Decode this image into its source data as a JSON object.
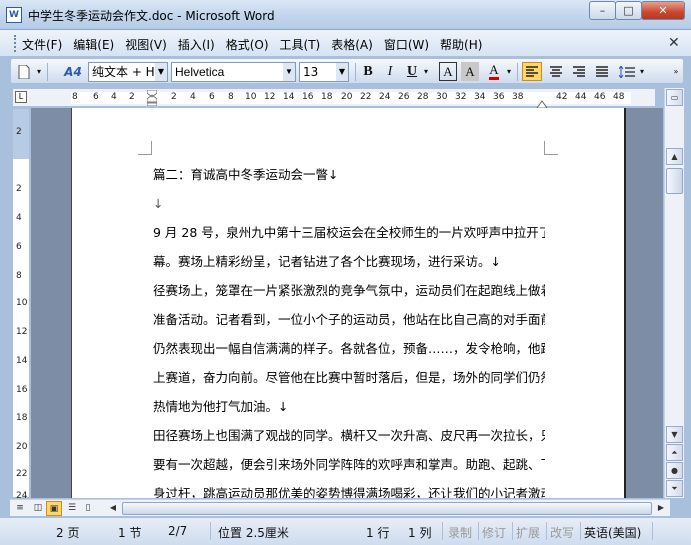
{
  "window": {
    "app_icon": "W",
    "title": "中学生冬季运动会作文.doc - Microsoft Word",
    "buttons": {
      "minimize": "–",
      "maximize": "□",
      "close": "✕"
    }
  },
  "menu": {
    "items": [
      "文件(F)",
      "编辑(E)",
      "视图(V)",
      "插入(I)",
      "格式(O)",
      "工具(T)",
      "表格(A)",
      "窗口(W)",
      "帮助(H)"
    ],
    "close_doc": "✕"
  },
  "toolbar": {
    "style": "纯文本 + H",
    "font": "Helvetica",
    "size": "13",
    "bold": "B",
    "italic": "I",
    "underline": "U",
    "style_icon": "A4",
    "char_border": "A",
    "char_shading": "A",
    "font_color": "A"
  },
  "ruler": {
    "corner": "L",
    "horizontal_ticks": [
      "8",
      "6",
      "4",
      "2",
      "2",
      "4",
      "6",
      "8",
      "10",
      "12",
      "14",
      "16",
      "18",
      "20",
      "22",
      "24",
      "26",
      "28",
      "30",
      "32",
      "34",
      "36",
      "38",
      "42",
      "44",
      "46",
      "48"
    ],
    "vertical_ticks": [
      "2",
      "2",
      "4",
      "6",
      "8",
      "10",
      "12",
      "14",
      "16",
      "18",
      "20",
      "22",
      "24"
    ]
  },
  "document": {
    "lines": [
      "篇二：育诚高中冬季运动会一瞥↓",
      "↓",
      "9 月 28 号，泉州九中第十三届校运会在全校师生的一片欢呼声中拉开了帷",
      "幕。赛场上精彩纷呈，记者钻进了各个比赛现场，进行采访。↓",
      "径赛场上，笼罩在一片紧张激烈的竞争气氛中，运动员们在起跑线上做着",
      "准备活动。记者看到，一位小个子的运动员，他站在比自己高的对手面前",
      "仍然表现出一幅自信满满的样子。各就各位，预备……，发令枪响，他跃",
      "上赛道，奋力向前。尽管他在比赛中暂时落后，但是，场外的同学们仍然",
      "热情地为他打气加油。↓",
      "田径赛场上也围满了观战的同学。横杆又一次升高、皮尺再一次拉长，只",
      "要有一次超越，便会引来场外同学阵阵的欢呼声和掌声。助跑、起跳、飞",
      "身过杆，跳高运动员那优美的姿势博得满场喝彩，还让我们的小记者激动"
    ]
  },
  "status": {
    "page": "2 页",
    "section": "1 节",
    "page_of": "2/7",
    "position": "位置 2.5厘米",
    "line": "1 行",
    "column": "1 列",
    "rec": "录制",
    "trk": "修订",
    "ext": "扩展",
    "ovr": "改写",
    "language": "英语(美国)"
  }
}
